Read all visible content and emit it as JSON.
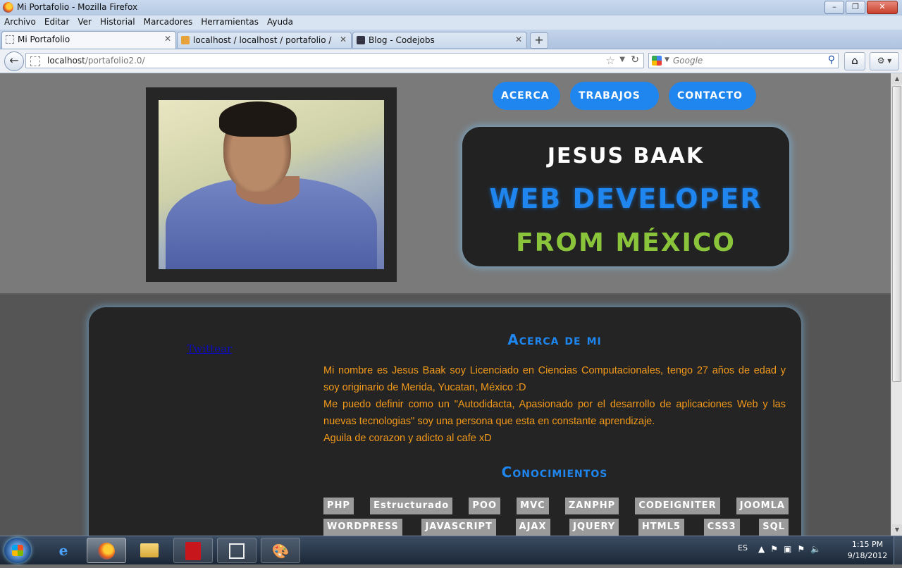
{
  "window": {
    "title": "Mi Portafolio - Mozilla Firefox",
    "controls": [
      "–",
      "❐",
      "✕"
    ]
  },
  "menu": [
    "Archivo",
    "Editar",
    "Ver",
    "Historial",
    "Marcadores",
    "Herramientas",
    "Ayuda"
  ],
  "tabs": [
    {
      "label": "Mi Portafolio",
      "active": true
    },
    {
      "label": "localhost / localhost / portafolio / pr...",
      "active": false
    },
    {
      "label": "Blog - Codejobs",
      "active": false
    }
  ],
  "newtab_label": "+",
  "navbar": {
    "url_host": "localhost",
    "url_path": "/portafolio2.0/",
    "search_placeholder": "Google"
  },
  "page": {
    "nav": [
      "ACERCA",
      "TRABAJOS",
      "CONTACTO"
    ],
    "hero": {
      "name": "JESUS BAAK",
      "role": "WEB DEVELOPER",
      "from": "FROM MÉXICO"
    },
    "twitter_link": "Twittear",
    "about": {
      "title": "Acerca de mi",
      "paragraphs": [
        "Mi nombre es Jesus Baak soy Licenciado en Ciencias Computacionales, tengo 27 años de edad y soy originario de Merida, Yucatan, México :D",
        "Me puedo definir como un \"Autodidacta, Apasionado por el desarrollo de aplicaciones Web y las nuevas tecnologias\" soy una persona que esta en constante aprendizaje.",
        "Aguila de corazon y adicto al cafe xD"
      ]
    },
    "skills": {
      "title": "Conocimientos",
      "row1": [
        "PHP",
        "Estructurado",
        "POO",
        "MVC",
        "ZANPHP",
        "CODEIGNITER",
        "JOOMLA"
      ],
      "row2": [
        "WORDPRESS",
        "JAVASCRIPT",
        "AJAX",
        "JQUERY",
        "HTML5",
        "CSS3",
        "SQL"
      ]
    }
  },
  "taskbar": {
    "language": "ES",
    "time": "1:15 PM",
    "date": "9/18/2012"
  }
}
